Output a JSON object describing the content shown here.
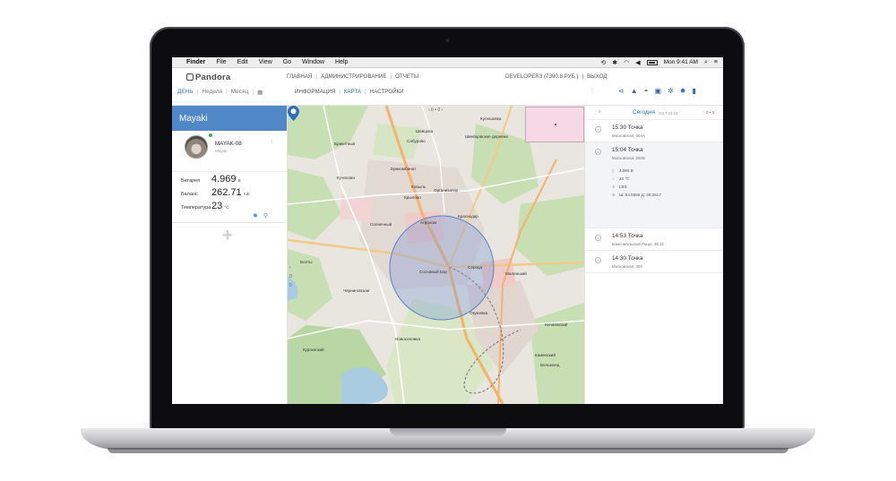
{
  "menubar": {
    "items": [
      "Finder",
      "File",
      "Edit",
      "View",
      "Go",
      "Window",
      "Help"
    ],
    "clock": "Mon 9:41 AM"
  },
  "app": {
    "logo": "Pandora",
    "periods": [
      "ДЕНЬ",
      "Неделя",
      "Месяц"
    ],
    "topnav": [
      "ГЛАВНАЯ",
      "АДМИНИСТРИРОВАНИЕ",
      "ОТЧЕТЫ"
    ],
    "subnav": [
      "ИНФОРМАЦИЯ",
      "КАРТА",
      "НАСТРОЙКИ"
    ],
    "account": "DEVELOPER3 (7390.8 РУБ.)",
    "logout": "ВЫХОД"
  },
  "panel": {
    "title": "Mayaki",
    "device": {
      "name": "MAYAK-08",
      "sub": "Mayak"
    },
    "stats": [
      {
        "label": "Батарея",
        "value": "4.969",
        "unit": "В"
      },
      {
        "label": "Баланс",
        "value": "262.71",
        "unit": "rub"
      },
      {
        "label": "Температура",
        "value": "23",
        "unit": "°С"
      }
    ],
    "add": "+"
  },
  "map": {
    "controls": "‹ 0 • 0 ›",
    "labels": [
      "Кулешовка",
      "Шевцово",
      "Сабурово",
      "Брикетный",
      "Швейцовские деревни",
      "Бумкомбинат",
      "Кучелово",
      "Ковыль",
      "Организатор",
      "Крылово",
      "Солнечный",
      "Агроном",
      "Краснодар",
      "Болты",
      "Сосновый Бор",
      "Середа",
      "Маленький",
      "Черниговская",
      "Новоселовка",
      "Курганский",
      "Окуневка",
      "Кенжовский",
      "Каменский",
      "Бельмонд"
    ]
  },
  "timeline": {
    "nav_left": "‹ 0",
    "today": "Сегодня",
    "date": "2017-10-18",
    "nav_right": "0 • 0",
    "events": [
      {
        "time": "15:30",
        "type": "Точка",
        "address": "Московская, 304А"
      },
      {
        "time": "15:04",
        "type": "Точка",
        "address": "Московская, 292В",
        "details": [
          "4.985 В",
          "24 °С",
          "LBS",
          "Ш: 54.5556 Д: 36.2617"
        ]
      },
      {
        "time": "14:53",
        "type": "Точка",
        "address": "Комсомольская Роща, 39,32"
      },
      {
        "time": "14:30",
        "type": "Точка",
        "address": "Московская, 303"
      }
    ]
  },
  "colors": {
    "accent": "#4f87c7",
    "map_park": "#c8dfb3",
    "map_water": "#a9cce3",
    "radius": "#7a98d6"
  }
}
